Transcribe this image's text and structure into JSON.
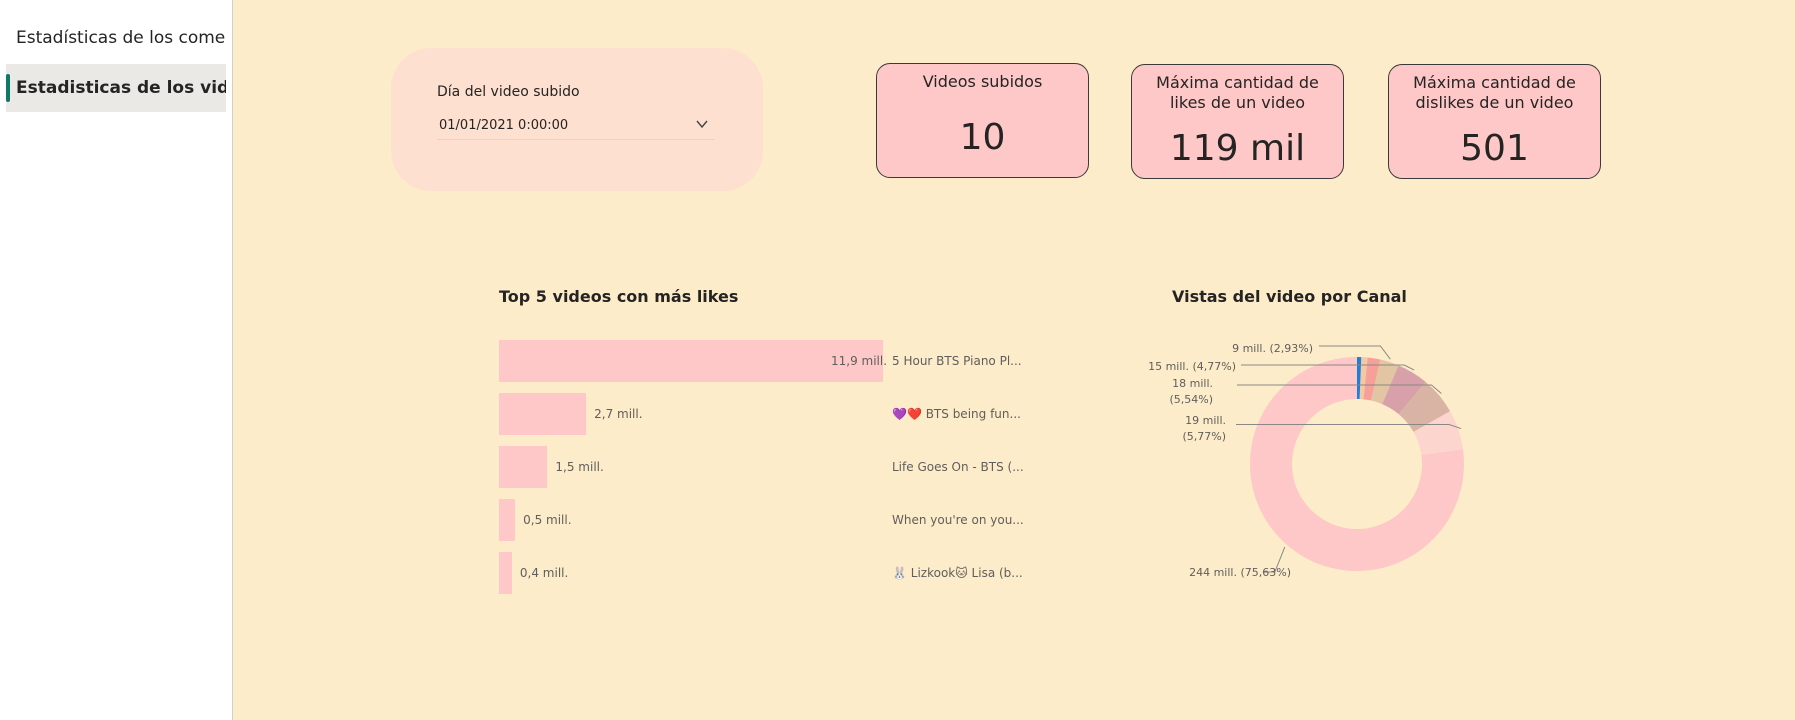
{
  "sidebar": {
    "pages": [
      {
        "label": "Estadísticas de los come..."
      },
      {
        "label": "Estadisticas de los videos"
      }
    ]
  },
  "slicer": {
    "title": "Día del video subido",
    "value": "01/01/2021 0:00:00"
  },
  "cards": [
    {
      "title_lines": [
        "Videos subidos"
      ],
      "value": "10"
    },
    {
      "title_lines": [
        "Máxima cantidad de",
        "likes de un video"
      ],
      "value": "119 mil"
    },
    {
      "title_lines": [
        "Máxima cantidad de",
        "dislikes de un video"
      ],
      "value": "501"
    }
  ],
  "colors": {
    "sidebar_active_marker": "#117865",
    "canvas_bg": "#fcecc9",
    "card_bg": "#fec8c8",
    "slicer_bg": "#fde0cf",
    "bar": "#fec8c8"
  },
  "chart_data": [
    {
      "type": "bar",
      "orientation": "horizontal",
      "title": "Top 5 videos con más likes",
      "categories": [
        "5 Hour BTS Piano Pl...",
        "💜❤️ BTS being fun...",
        "Life Goes On - BTS (...",
        "When you're on you...",
        "🐰 Lizkook🐱 Lisa (b..."
      ],
      "values": [
        11.9,
        2.7,
        1.5,
        0.5,
        0.4
      ],
      "value_labels": [
        "11,9 mill.",
        "2,7 mill.",
        "1,5 mill.",
        "0,5 mill.",
        "0,4 mill."
      ]
    },
    {
      "type": "pie",
      "donut": true,
      "title": "Vistas del video por Canal",
      "slices": [
        {
          "value": 244,
          "percent": 75.63,
          "label": "244 mill. (75,63%)",
          "color": "#fec8c8"
        },
        {
          "value": 19,
          "percent": 5.77,
          "label_lines": [
            "19 mill.",
            "(5,77%)"
          ],
          "color": "#fdd5cf"
        },
        {
          "value": 18,
          "percent": 5.54,
          "label_lines": [
            "18 mill.",
            "(5,54%)"
          ],
          "color": "#d9b3a3"
        },
        {
          "value": 15,
          "percent": 4.77,
          "label": "15 mill. (4,77%)",
          "color": "#d8a0a8"
        },
        {
          "value": 9,
          "percent": 2.93,
          "label": "9 mill. (2,93%)",
          "color": "#e2c6a3"
        },
        {
          "value": 6,
          "percent": 2.0,
          "color": "#f7a09a"
        },
        {
          "value": 3,
          "percent": 1.0,
          "color": "#f2c9a0"
        },
        {
          "value": 2,
          "percent": 0.6,
          "color": "#1f7ed8"
        }
      ]
    }
  ]
}
